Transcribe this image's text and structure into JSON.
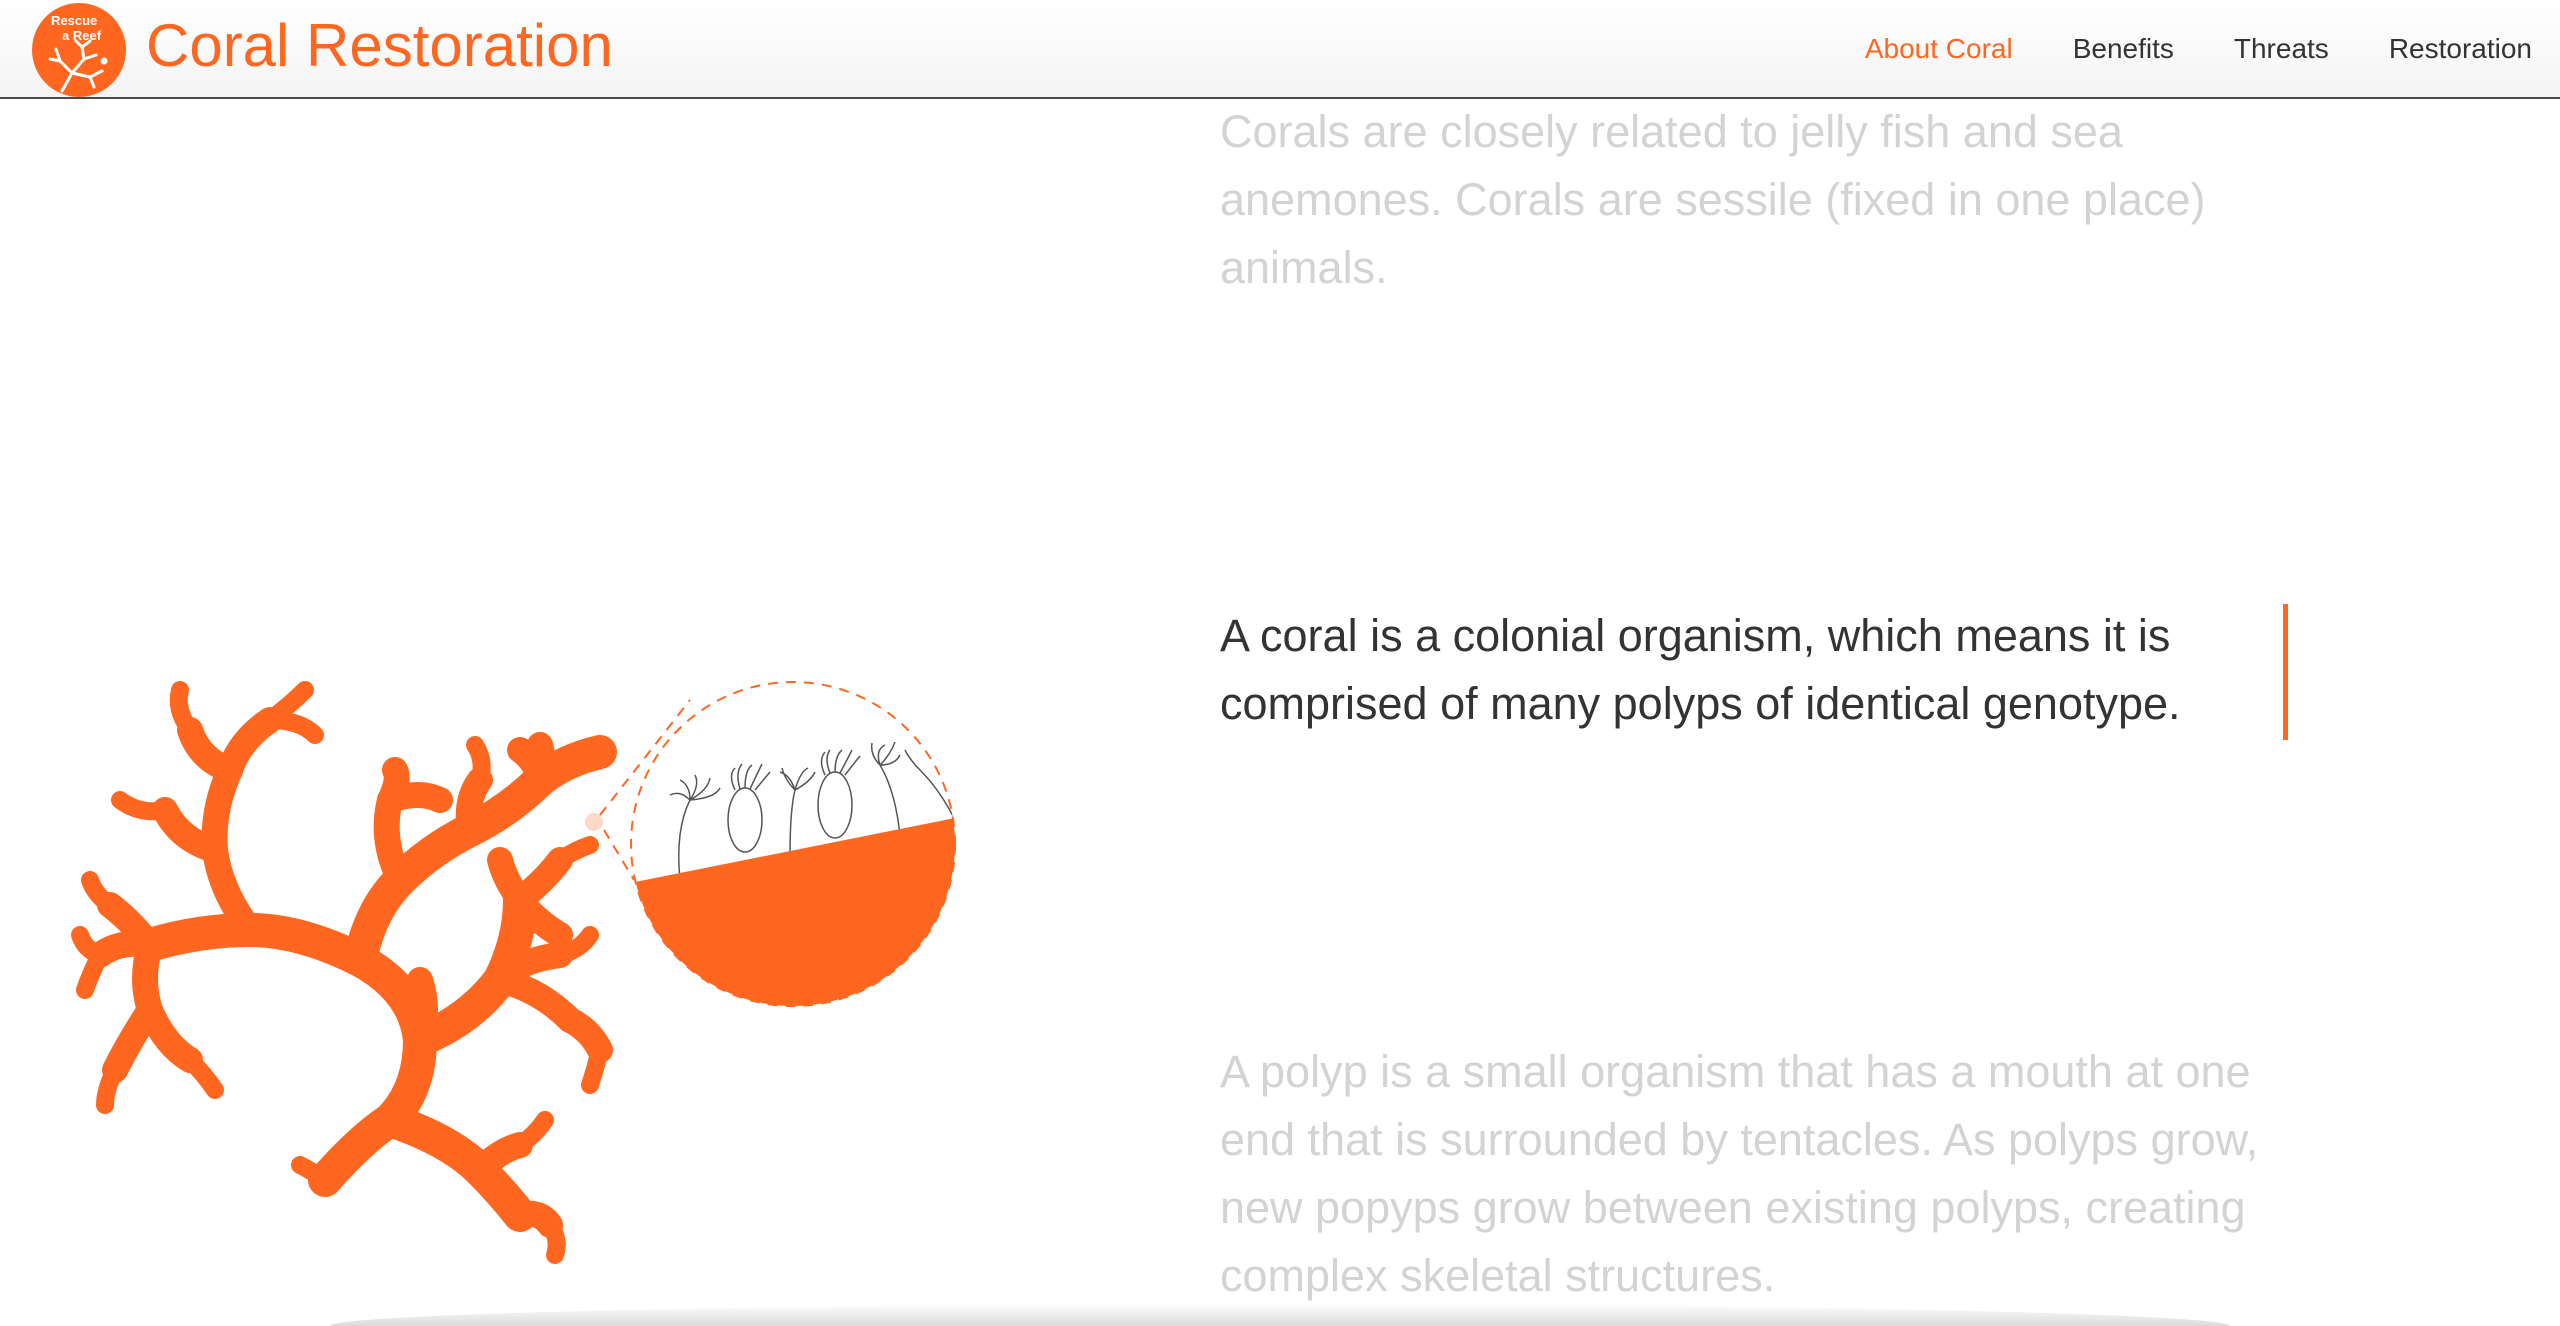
{
  "header": {
    "logo_line1": "Rescue",
    "logo_line2": "a Reef",
    "title": "Coral Restoration"
  },
  "nav": {
    "items": [
      {
        "label": "About Coral",
        "active": true
      },
      {
        "label": "Benefits",
        "active": false
      },
      {
        "label": "Threats",
        "active": false
      },
      {
        "label": "Restoration",
        "active": false
      }
    ]
  },
  "story": {
    "paragraphs": [
      {
        "text": "Corals are closely related to jelly fish and sea anemones. Corals are sessile (fixed in one place) animals.",
        "state": "faded"
      },
      {
        "text": "A coral is a colonial organism, which means it is comprised of many polyps of identical genotype.",
        "state": "active"
      },
      {
        "text": "A polyp is a small organism that has a mouth at one end that is surrounded by tentacles. As polyps grow, new popyps grow between existing polyps, creating complex skeletal structures.",
        "state": "faded"
      }
    ]
  },
  "colors": {
    "accent": "#ff6720",
    "text_active": "#333333",
    "text_faded": "#d3d3d3"
  },
  "icons": {
    "logo": "coral-branch-icon",
    "illustration": "branching-coral",
    "magnifier": "polyp-magnifier-circle"
  }
}
